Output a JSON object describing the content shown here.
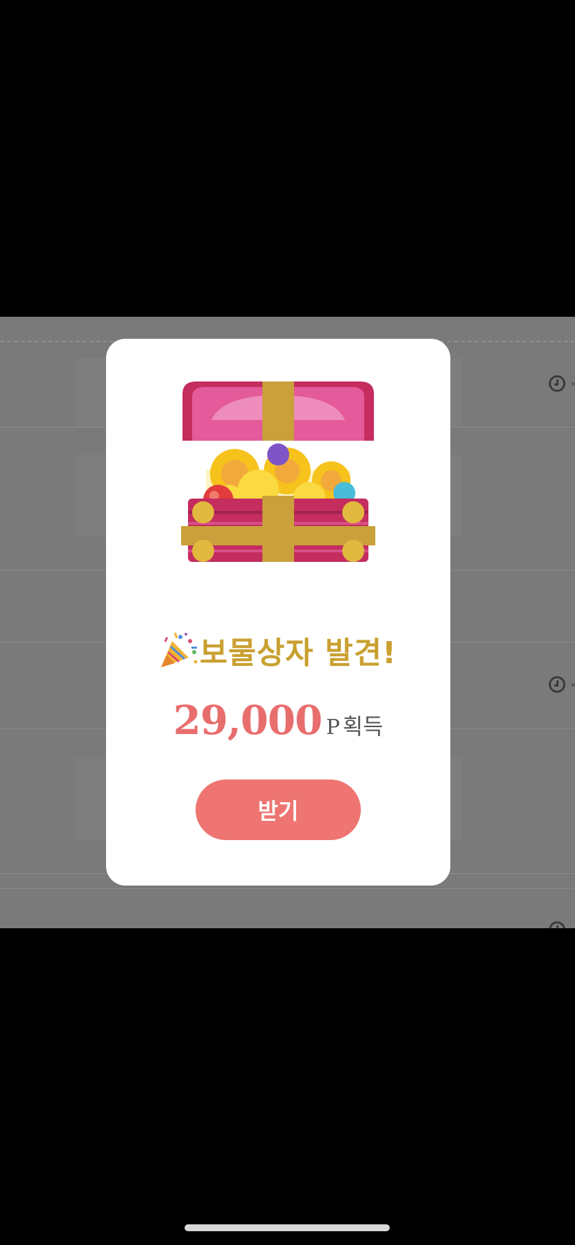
{
  "modal": {
    "title": "보물상자 발견!",
    "reward_amount": "29,000",
    "reward_unit": "P",
    "reward_suffix": "획득",
    "receive_button_label": "받기"
  },
  "icons": {
    "celebration": "party-popper-icon",
    "chest": "treasure-chest-icon",
    "clock": "clock-icon"
  },
  "colors": {
    "title": "#c9a030",
    "reward_amount": "#e86d6d",
    "button": "#ee7571",
    "chest_body": "#c42d5e",
    "chest_lid": "#e45a9a",
    "ribbon": "#c9a03a"
  }
}
